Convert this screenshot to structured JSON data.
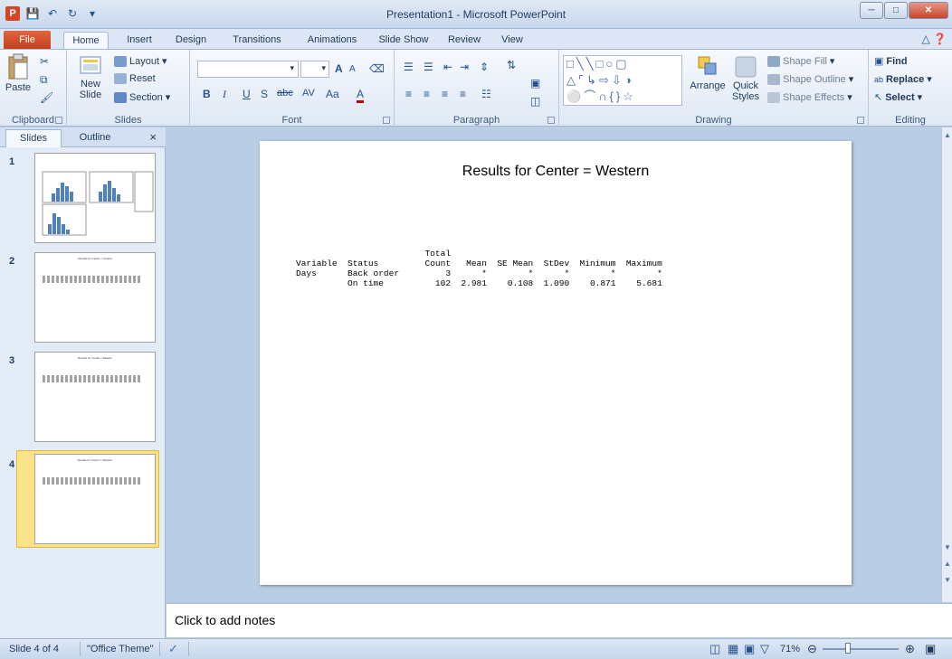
{
  "window": {
    "title": "Presentation1  -  Microsoft PowerPoint",
    "app_icon_letter": "P"
  },
  "tabs": {
    "file": "File",
    "items": [
      "Home",
      "Insert",
      "Design",
      "Transitions",
      "Animations",
      "Slide Show",
      "Review",
      "View"
    ],
    "active": "Home"
  },
  "ribbon": {
    "clipboard": {
      "paste": "Paste",
      "label": "Clipboard"
    },
    "slides": {
      "new_slide": "New",
      "new_slide_2": "Slide",
      "layout": "Layout",
      "reset": "Reset",
      "section": "Section",
      "label": "Slides"
    },
    "font": {
      "label": "Font",
      "bold": "B",
      "italic": "I",
      "underline": "U",
      "strike": "abc",
      "size_up": "A",
      "size_down": "A",
      "change_case": "Aa",
      "font_color": "A"
    },
    "paragraph": {
      "label": "Paragraph"
    },
    "drawing": {
      "label": "Drawing",
      "arrange": "Arrange",
      "quick_styles": "Quick",
      "quick_styles_2": "Styles",
      "shape_fill": "Shape Fill",
      "shape_outline": "Shape Outline",
      "shape_effects": "Shape Effects"
    },
    "editing": {
      "label": "Editing",
      "find": "Find",
      "replace": "Replace",
      "select": "Select"
    }
  },
  "panel": {
    "tab_slides": "Slides",
    "tab_outline": "Outline",
    "close": "×",
    "thumbs": [
      {
        "num": "1"
      },
      {
        "num": "2",
        "title": "Results for Center = Central"
      },
      {
        "num": "3",
        "title": "Results for Center = Eastern"
      },
      {
        "num": "4",
        "title": "Results for Center = Western",
        "selected": true
      }
    ]
  },
  "slide": {
    "title": "Results for Center = Western",
    "table_text": "                         Total\nVariable  Status         Count   Mean  SE Mean  StDev  Minimum  Maximum\nDays      Back order         3      *        *      *        *        *\n          On time          102  2.981    0.108  1.090    0.871    5.681"
  },
  "notes": {
    "placeholder": "Click to add notes"
  },
  "status": {
    "slide_info": "Slide 4 of 4",
    "theme": "\"Office Theme\"",
    "zoom": "71%"
  }
}
